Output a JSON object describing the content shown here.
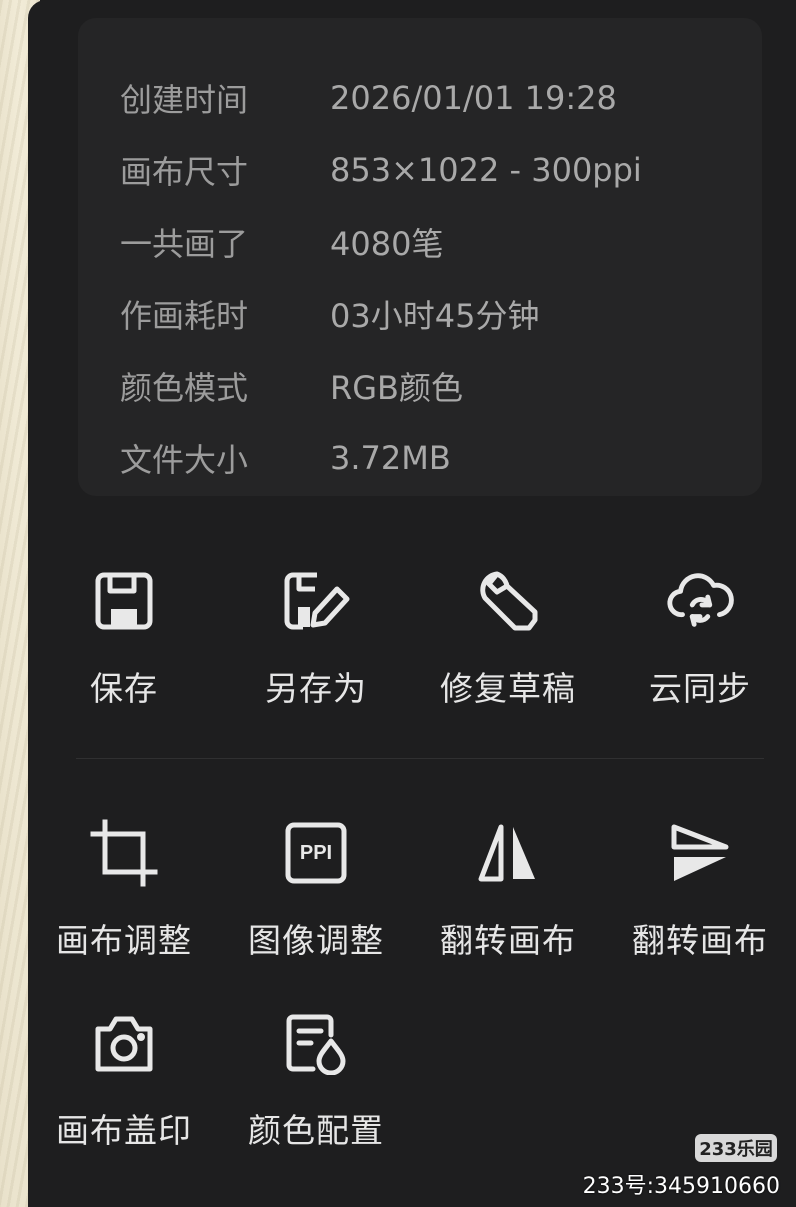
{
  "info": [
    {
      "key": "创建时间",
      "value": "2026/01/01 19:28"
    },
    {
      "key": "画布尺寸",
      "value": "853×1022 - 300ppi"
    },
    {
      "key": "一共画了",
      "value": "4080笔"
    },
    {
      "key": "作画耗时",
      "value": "03小时45分钟"
    },
    {
      "key": "颜色模式",
      "value": "RGB颜色"
    },
    {
      "key": "文件大小",
      "value": "3.72MB"
    }
  ],
  "actions_row1": [
    {
      "label": "保存",
      "icon": "save-icon"
    },
    {
      "label": "另存为",
      "icon": "save-as-icon"
    },
    {
      "label": "修复草稿",
      "icon": "wrench-icon"
    },
    {
      "label": "云同步",
      "icon": "cloud-sync-icon"
    }
  ],
  "actions_row2": [
    {
      "label": "画布调整",
      "icon": "crop-icon"
    },
    {
      "label": "图像调整",
      "icon": "ppi-icon",
      "icon_text": "PPI"
    },
    {
      "label": "翻转画布",
      "icon": "flip-horizontal-icon"
    },
    {
      "label": "翻转画布",
      "icon": "flip-vertical-icon"
    }
  ],
  "actions_row3": [
    {
      "label": "画布盖印",
      "icon": "camera-icon"
    },
    {
      "label": "颜色配置",
      "icon": "color-profile-icon"
    }
  ],
  "watermark": {
    "logo": "233乐园",
    "text": "233号:345910660"
  },
  "colors": {
    "panel_bg": "#1e1e1f",
    "card_bg": "#252526",
    "info_text": "#9c9c9c",
    "label_text": "#e6e6e6",
    "icon": "#e8e8e8"
  }
}
